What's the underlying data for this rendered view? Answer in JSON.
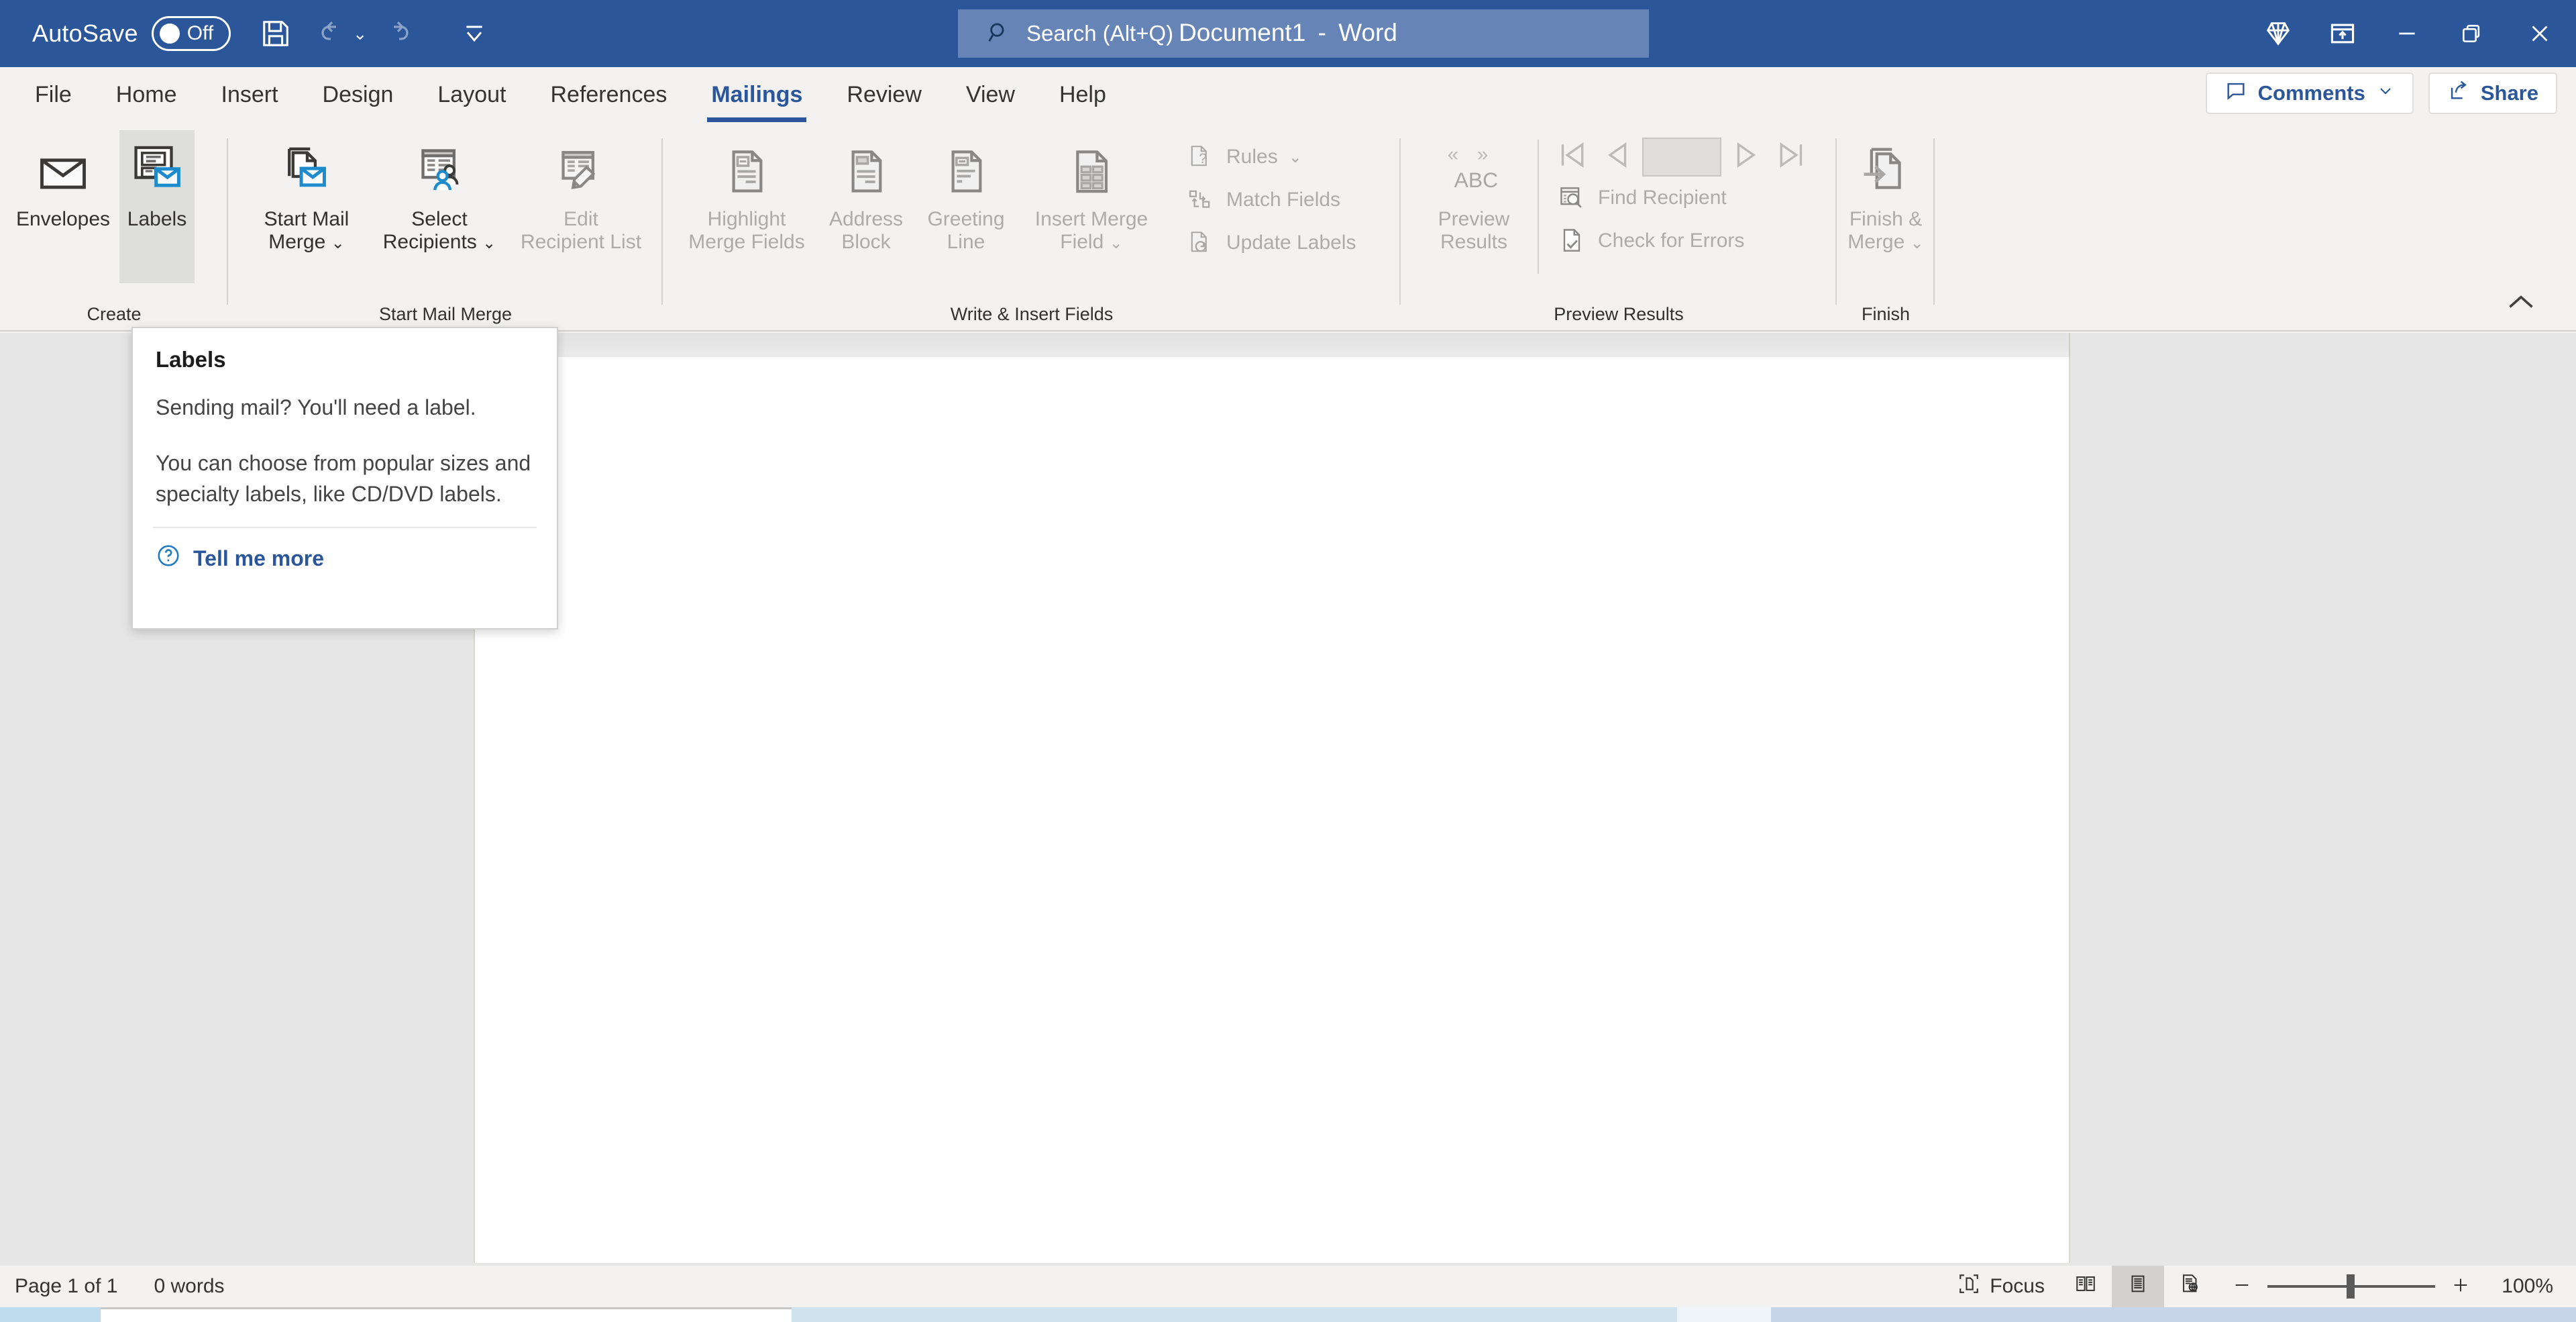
{
  "titlebar": {
    "autosave_label": "AutoSave",
    "autosave_state": "Off",
    "document_title": "Document1",
    "title_separator": "-",
    "app_name": "Word",
    "save_icon": "save-icon",
    "undo_icon": "undo-icon",
    "redo_icon": "redo-icon",
    "customize_qat_icon": "customize-quick-access-toolbar-icon",
    "search_placeholder": "Search (Alt+Q)",
    "search_icon": "search-icon",
    "diamond_icon": "office-diamond-icon",
    "ribbon_display_icon": "ribbon-display-options-icon",
    "minimize_icon": "minimize-icon",
    "restore_icon": "restore-icon",
    "close_icon": "close-icon"
  },
  "tabs": [
    {
      "label": "File",
      "active": false
    },
    {
      "label": "Home",
      "active": false
    },
    {
      "label": "Insert",
      "active": false
    },
    {
      "label": "Design",
      "active": false
    },
    {
      "label": "Layout",
      "active": false
    },
    {
      "label": "References",
      "active": false
    },
    {
      "label": "Mailings",
      "active": true
    },
    {
      "label": "Review",
      "active": false
    },
    {
      "label": "View",
      "active": false
    },
    {
      "label": "Help",
      "active": false
    }
  ],
  "tabbar_right": {
    "comments_label": "Comments",
    "comments_icon": "comment-icon",
    "comments_chevron": "chevron-down-icon",
    "share_label": "Share",
    "share_icon": "share-icon"
  },
  "ribbon": {
    "collapse_icon": "collapse-ribbon-chevron-up-icon",
    "groups": [
      {
        "name": "create",
        "label": "Create",
        "buttons": [
          {
            "label": "Envelopes",
            "icon": "envelope-icon",
            "disabled": false,
            "hover": false
          },
          {
            "label": "Labels",
            "icon": "labels-icon",
            "disabled": false,
            "hover": true
          }
        ]
      },
      {
        "name": "start-mail-merge",
        "label": "Start Mail Merge",
        "buttons": [
          {
            "label": "Start Mail Merge",
            "line1": "Start Mail",
            "line2": "Merge",
            "icon": "start-mail-merge-icon",
            "dropdown": true,
            "disabled": false
          },
          {
            "label": "Select Recipients",
            "line1": "Select",
            "line2": "Recipients",
            "icon": "select-recipients-icon",
            "dropdown": true,
            "disabled": false
          },
          {
            "label": "Edit Recipient List",
            "line1": "Edit",
            "line2": "Recipient List",
            "icon": "edit-recipient-list-icon",
            "dropdown": false,
            "disabled": true
          }
        ]
      },
      {
        "name": "write-insert-fields",
        "label": "Write & Insert Fields",
        "buttons": [
          {
            "label": "Highlight Merge Fields",
            "line1": "Highlight",
            "line2": "Merge Fields",
            "icon": "highlight-merge-fields-icon",
            "dropdown": false,
            "disabled": true
          },
          {
            "label": "Address Block",
            "line1": "Address",
            "line2": "Block",
            "icon": "address-block-icon",
            "dropdown": false,
            "disabled": true
          },
          {
            "label": "Greeting Line",
            "line1": "Greeting",
            "line2": "Line",
            "icon": "greeting-line-icon",
            "dropdown": false,
            "disabled": true
          },
          {
            "label": "Insert Merge Field",
            "line1": "Insert Merge",
            "line2": "Field",
            "icon": "insert-merge-field-icon",
            "dropdown": true,
            "disabled": true
          }
        ],
        "small_buttons": [
          {
            "label": "Rules",
            "icon": "rules-icon",
            "dropdown": true,
            "disabled": true
          },
          {
            "label": "Match Fields",
            "icon": "match-fields-icon",
            "dropdown": false,
            "disabled": true
          },
          {
            "label": "Update Labels",
            "icon": "update-labels-icon",
            "dropdown": false,
            "disabled": true
          }
        ]
      },
      {
        "name": "preview-results",
        "label": "Preview Results",
        "buttons": [
          {
            "label": "Preview Results",
            "line1": "Preview",
            "line2": "Results",
            "icon": "preview-results-abc-icon",
            "badge": "ABC",
            "dropdown": false,
            "disabled": true
          }
        ],
        "navigation": {
          "first_record_icon": "first-record-icon",
          "previous_record_icon": "previous-record-icon",
          "record_number_value": "",
          "next_record_icon": "next-record-icon",
          "last_record_icon": "last-record-icon"
        },
        "small_buttons": [
          {
            "label": "Find Recipient",
            "icon": "find-recipient-icon",
            "disabled": true
          },
          {
            "label": "Check for Errors",
            "icon": "check-for-errors-icon",
            "disabled": true
          }
        ]
      },
      {
        "name": "finish",
        "label": "Finish",
        "buttons": [
          {
            "label": "Finish & Merge",
            "line1": "Finish &",
            "line2": "Merge",
            "icon": "finish-and-merge-icon",
            "dropdown": true,
            "disabled": true
          }
        ]
      }
    ]
  },
  "tooltip": {
    "title": "Labels",
    "paragraph1": "Sending mail? You'll need a label.",
    "paragraph2": "You can choose from popular sizes and specialty labels, like CD/DVD labels.",
    "link_label": "Tell me more",
    "link_icon": "help-question-circle-icon"
  },
  "statusbar": {
    "page_info": "Page 1 of 1",
    "word_count": "0 words",
    "focus_label": "Focus",
    "focus_icon": "focus-mode-icon",
    "read_mode_icon": "read-mode-icon",
    "print_layout_icon": "print-layout-icon",
    "web_layout_icon": "web-layout-icon",
    "zoom_out_icon": "zoom-out-minus-icon",
    "zoom_in_icon": "zoom-in-plus-icon",
    "zoom_level": "100%"
  },
  "colors": {
    "titlebar_blue": "#2b579a",
    "ribbon_bg": "#f3f2f1",
    "accent_icon_blue": "#1e8bcd",
    "canvas_gray": "#e6e6e6",
    "disabled_gray": "#adacab"
  }
}
